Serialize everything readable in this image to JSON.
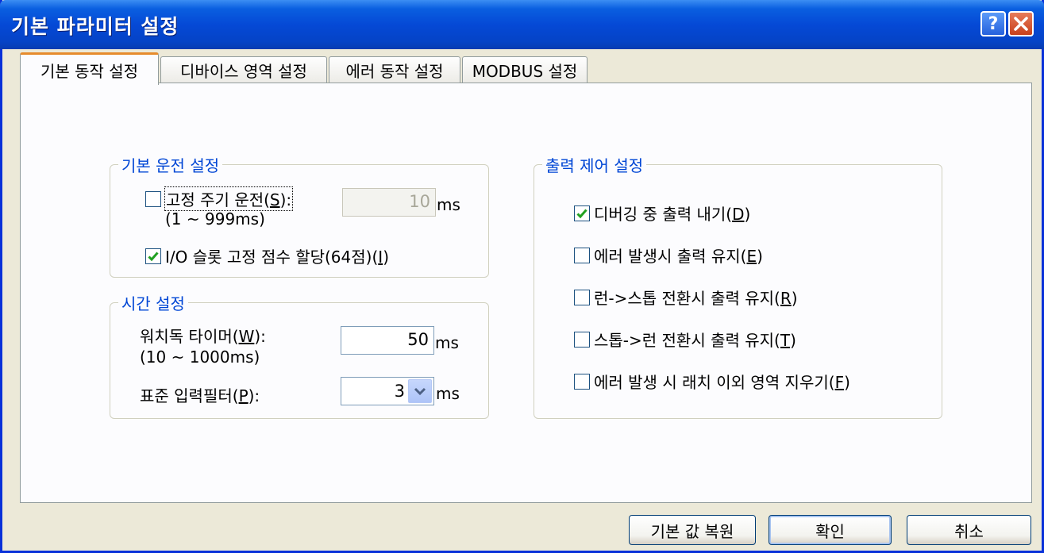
{
  "window": {
    "title": "기본 파라미터 설정"
  },
  "tabs": [
    {
      "label": "기본 동작 설정"
    },
    {
      "label": "디바이스 영역 설정"
    },
    {
      "label": "에러 동작 설정"
    },
    {
      "label": "MODBUS 설정"
    }
  ],
  "basic_run": {
    "title": "기본 운전 설정",
    "fixed_cycle": {
      "label_prefix": "고정 주기 운전(",
      "mnemonic": "S",
      "label_suffix": "):",
      "checked": false
    },
    "fixed_cycle_range": "(1 ~ 999ms)",
    "fixed_cycle_value": "10",
    "fixed_cycle_unit": "ms",
    "io_slot": {
      "label_prefix": "I/O 슬롯 고정 점수 할당(64점)(",
      "mnemonic": "I",
      "label_suffix": ")",
      "checked": true
    }
  },
  "time": {
    "title": "시간 설정",
    "watchdog": {
      "label_prefix": "워치독 타이머(",
      "mnemonic": "W",
      "label_suffix": "):"
    },
    "watchdog_range": "(10 ~ 1000ms)",
    "watchdog_value": "50",
    "watchdog_unit": "ms",
    "filter": {
      "label_prefix": "표준 입력필터(",
      "mnemonic": "P",
      "label_suffix": "):"
    },
    "filter_value": "3",
    "filter_unit": "ms"
  },
  "output": {
    "title": "출력 제어 설정",
    "items": [
      {
        "prefix": "디버깅 중 출력 내기(",
        "mnemonic": "D",
        "suffix": ")",
        "checked": true
      },
      {
        "prefix": "에러 발생시 출력 유지(",
        "mnemonic": "E",
        "suffix": ")",
        "checked": false
      },
      {
        "prefix": "런->스톱 전환시 출력 유지(",
        "mnemonic": "R",
        "suffix": ")",
        "checked": false
      },
      {
        "prefix": "스톱->런 전환시 출력 유지(",
        "mnemonic": "T",
        "suffix": ")",
        "checked": false
      },
      {
        "prefix": "에러 발생 시 래치 이외 영역 지우기(",
        "mnemonic": "F",
        "suffix": ")",
        "checked": false
      }
    ]
  },
  "buttons": {
    "restore": "기본 값 복원",
    "ok": "확인",
    "cancel": "취소"
  },
  "icons": {
    "help": "help-icon",
    "close": "close-icon",
    "check": "check-icon",
    "dropdown": "chevron-down-icon"
  },
  "colors": {
    "title_blue": "#0549d6",
    "group_title": "#0046d5",
    "check_green": "#21a121",
    "active_tab": "#e68b2c"
  }
}
